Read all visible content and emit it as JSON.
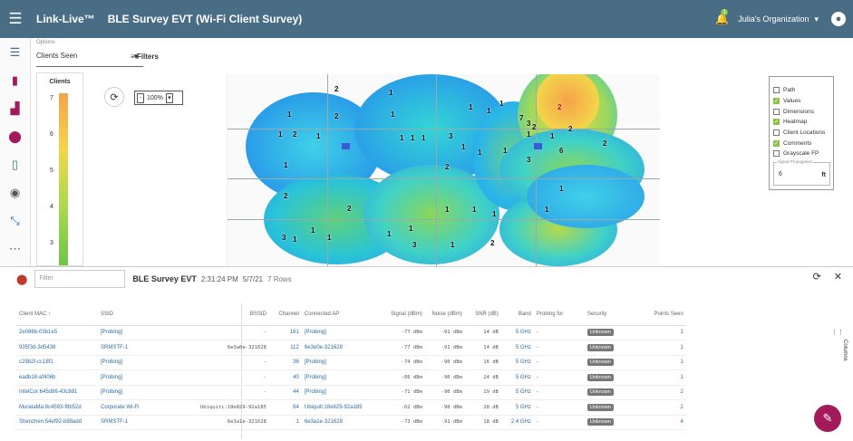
{
  "header": {
    "app_name": "Link-Live™",
    "project_name": "BLE Survey EVT (Wi-Fi Client Survey)",
    "org": "Julia's Organization",
    "notify_count": "1"
  },
  "controls": {
    "options_label": "Options",
    "options_value": "Clients Seen",
    "filters_label": "Filters",
    "zoom": "100%"
  },
  "legend": {
    "title": "Clients",
    "ticks": [
      "7",
      "6",
      "5",
      "4",
      "3"
    ]
  },
  "map_aps": [
    "2",
    "1",
    "1",
    "2",
    "1",
    "1",
    "2",
    "1",
    "1",
    "1",
    "1",
    "3",
    "1",
    "1",
    "1",
    "1",
    "2",
    "1",
    "1",
    "1",
    "2",
    "2",
    "3",
    "1",
    "1",
    "3",
    "7",
    "2",
    "2",
    "6",
    "2",
    "1",
    "2",
    "1",
    "1",
    "1",
    "1",
    "1",
    "1",
    "1",
    "1",
    "1",
    "3",
    "1",
    "2",
    "3"
  ],
  "layers": {
    "items": [
      {
        "label": "Path",
        "on": false
      },
      {
        "label": "Values",
        "on": true
      },
      {
        "label": "Dimensions",
        "on": false
      },
      {
        "label": "Heatmap",
        "on": true
      },
      {
        "label": "Client Locations",
        "on": false
      },
      {
        "label": "Comments",
        "on": true
      },
      {
        "label": "Grayscale FP",
        "on": false
      }
    ],
    "signal_label": "Signal Propagation",
    "signal_value": "6",
    "signal_unit": "ft"
  },
  "panel": {
    "filter_placeholder": "Filter",
    "title": "BLE Survey EVT",
    "time": "2:31:24 PM",
    "date": "5/7/21",
    "rows_label": "7 Rows",
    "columns_label": "Columns"
  },
  "table": {
    "headers": [
      "Client MAC ↑",
      "SSID",
      "BSSID",
      "Channel",
      "Connected AP",
      "Signal (dBm)",
      "Noise (dBm)",
      "SNR (dB)",
      "Band",
      "Probing for",
      "Security",
      "Points Seen"
    ],
    "rows": [
      [
        "2e086b-03b1e5",
        "[Probing]",
        "-",
        "161",
        "[Probing]",
        "-77 dBm",
        "-91 dBm",
        "14 dB",
        "5 GHz",
        "-",
        "Unknown",
        "1"
      ],
      [
        "935f3d-3d5438",
        "SRMSTF-1",
        "6e3a0e-321628",
        "112",
        "6e3e0e-321628",
        "-77 dBm",
        "-91 dBm",
        "14 dB",
        "5 GHz",
        "-",
        "Unknown",
        "1"
      ],
      [
        "c29b2f-cc18f1",
        "[Probing]",
        "-",
        "36",
        "[Probing]",
        "-74 dBm",
        "-90 dBm",
        "16 dB",
        "5 GHz",
        "-",
        "Unknown",
        "1"
      ],
      [
        "eadb18-af406b",
        "[Probing]",
        "-",
        "40",
        "[Probing]",
        "-66 dBm",
        "-90 dBm",
        "24 dB",
        "5 GHz",
        "-",
        "Unknown",
        "1"
      ],
      [
        "IntelCor:645d86-43c881",
        "[Probing]",
        "-",
        "44",
        "[Probing]",
        "-71 dBm",
        "-90 dBm",
        "19 dB",
        "5 GHz",
        "-",
        "Unknown",
        "2"
      ],
      [
        "MurataMa:8c4593-f8b52d",
        "Corporate Wi-Fi",
        "Ubiquiti:18e829-92a185",
        "64",
        "Ubiquiti:18e829-92a185",
        "-62 dBm",
        "-90 dBm",
        "28 dB",
        "5 GHz",
        "-",
        "Unknown",
        "2"
      ],
      [
        "Shenzhen:54ef92-b88add",
        "SRMSTF-1",
        "6e3a1e-321628",
        "1",
        "6e3a1e-321628",
        "-73 dBm",
        "-91 dBm",
        "18 dB",
        "2.4 GHz",
        "-",
        "Unknown",
        "4"
      ]
    ]
  }
}
